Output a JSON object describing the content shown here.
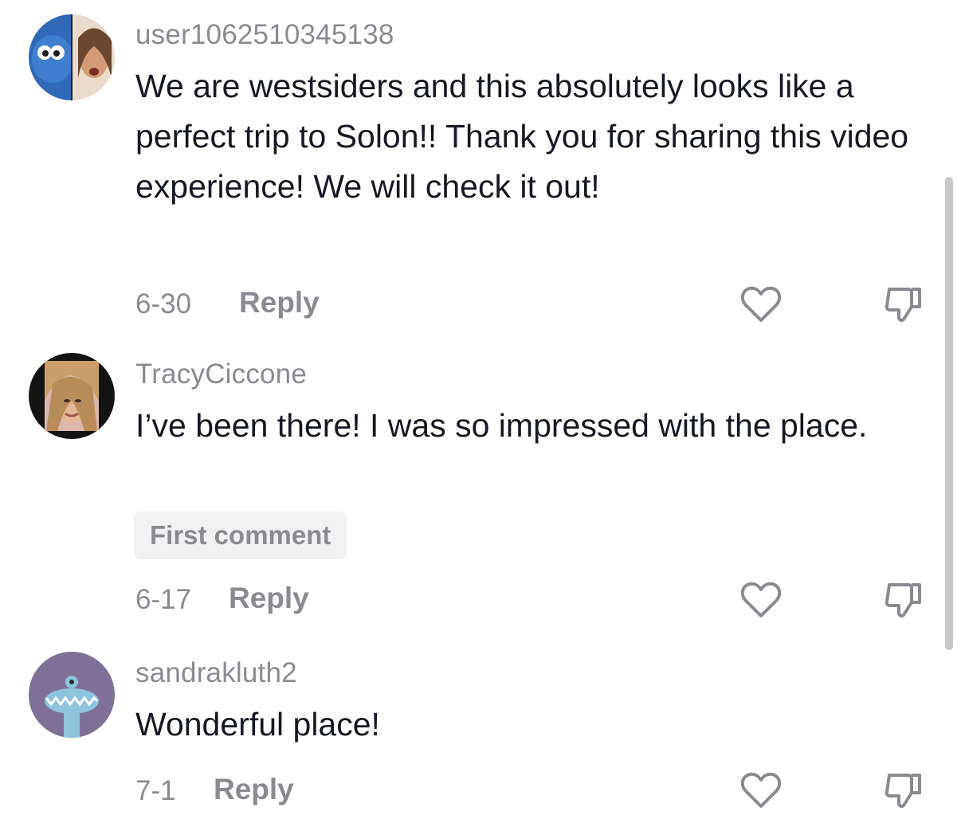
{
  "comments": [
    {
      "username": "user1062510345138",
      "text": "We are westsiders and this absolutely looks like a perfect trip to Solon!! Thank you for sharing this video experience! We will check it out!",
      "date": "6-30",
      "reply_label": "Reply"
    },
    {
      "username": "TracyCiccone",
      "text": "I’ve been there! I was so impressed with the place.",
      "badge": "First comment",
      "date": "6-17",
      "reply_label": "Reply"
    },
    {
      "username": "sandrakluth2",
      "text": "Wonderful place!",
      "date": "7-1",
      "reply_label": "Reply"
    }
  ],
  "icons": {
    "like": "heart-outline-icon",
    "dislike": "thumbs-down-outline-icon"
  },
  "colors": {
    "text": "#161823",
    "muted": "#8a8b91",
    "badge_bg": "#f1f1f2",
    "scrollbar": "#c9c9cc"
  }
}
